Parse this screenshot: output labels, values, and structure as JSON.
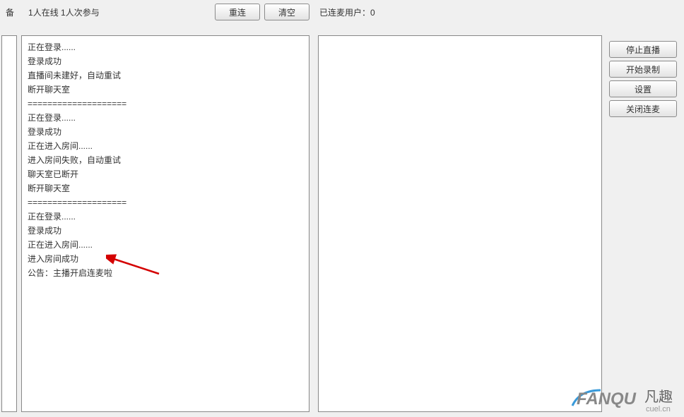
{
  "top_bar": {
    "status_prefix": "备",
    "online_status": "1人在线 1人次参与",
    "reconnect_label": "重连",
    "clear_label": "清空",
    "connected_users_label": "已连麦用户：",
    "connected_users_count": "0"
  },
  "log": {
    "lines": [
      "正在登录......",
      "登录成功",
      "直播间未建好，自动重试",
      "断开聊天室",
      "====================",
      "正在登录......",
      "登录成功",
      "正在进入房间......",
      "进入房间失败，自动重试",
      "聊天室已断开",
      "断开聊天室",
      "====================",
      "正在登录......",
      "登录成功",
      "正在进入房间......",
      "进入房间成功",
      "公告：主播开启连麦啦"
    ]
  },
  "side_actions": {
    "stop_live_label": "停止直播",
    "start_record_label": "开始录制",
    "settings_label": "设置",
    "close_mic_label": "关闭连麦"
  },
  "watermark": {
    "brand": "FANQU",
    "cn": "凡趣",
    "domain": "cuel.cn"
  }
}
